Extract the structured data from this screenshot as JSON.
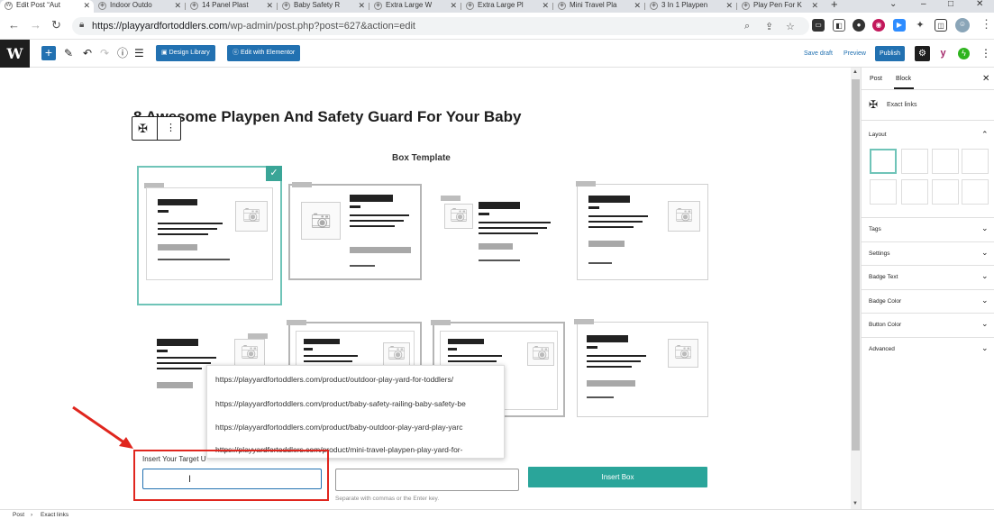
{
  "browser": {
    "tabs": [
      {
        "label": "Edit Post “Aut"
      },
      {
        "label": "Indoor Outdo"
      },
      {
        "label": "14 Panel Plast"
      },
      {
        "label": "Baby Safety R"
      },
      {
        "label": "Extra Large W"
      },
      {
        "label": "Extra Large Pl"
      },
      {
        "label": "Mini Travel Pla"
      },
      {
        "label": "3 In 1 Playpen"
      },
      {
        "label": "Play Pen For K"
      }
    ],
    "new_tab": "+",
    "url_host": "https://playyardfortoddlers.com",
    "url_path": "/wp-admin/post.php?post=627&action=edit"
  },
  "toolbar": {
    "design_library": "Design Library",
    "edit_elementor": "Edit with Elementor",
    "save_draft": "Save draft",
    "preview": "Preview",
    "publish": "Publish"
  },
  "editor": {
    "title": "8 Awesome Playpen And Safety Guard For Your Baby",
    "box_template_label": "Box Template",
    "dropdown_items": [
      "https://playyardfortoddlers.com/product/outdoor-play-yard-for-toddlers/",
      "https://playyardfortoddlers.com/product/baby-safety-railing-baby-safety-be",
      "https://playyardfortoddlers.com/product/baby-outdoor-play-yard-play-yarc",
      "https://playyardfortoddlers.com/product/mini-travel-playpen-play-yard-for-"
    ],
    "target_url_label": "Insert Your Target U",
    "target_url_value": "",
    "tags_value": "",
    "helper_text": "Separate with commas or the Enter key.",
    "insert_box": "Insert Box"
  },
  "sidebar": {
    "tab_post": "Post",
    "tab_block": "Block",
    "block_name": "Exact links",
    "sections": [
      "Layout",
      "Tags",
      "Settings",
      "Badge Text",
      "Badge Color",
      "Button Color",
      "Advanced"
    ]
  },
  "footer": {
    "crumb_post": "Post",
    "crumb_sep": "›",
    "crumb_block": "Exact links"
  },
  "colors": {
    "wp_blue": "#2271b1",
    "teal": "#2aa59a",
    "highlight_red": "#e0261e"
  }
}
